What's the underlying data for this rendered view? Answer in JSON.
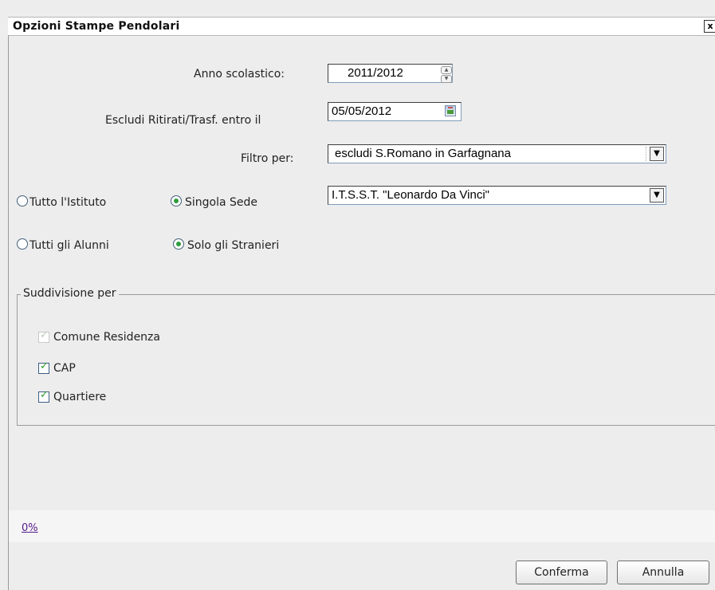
{
  "dialog": {
    "title": "Opzioni Stampe Pendolari",
    "close_label": "x"
  },
  "form": {
    "anno_label": "Anno scolastico:",
    "anno_value": "2011/2012",
    "escludi_label": "Escludi Ritirati/Trasf. entro il",
    "escludi_value": "05/05/2012",
    "filtro_label": "Filtro per:",
    "filtro_value": "escludi S.Romano in Garfagnana",
    "sede_value": "I.T.S.S.T. \"Leonardo Da Vinci\""
  },
  "radios": {
    "tutto_istituto": "Tutto l'Istituto",
    "singola_sede": "Singola Sede",
    "tutti_alunni": "Tutti gli Alunni",
    "solo_stranieri": "Solo gli Stranieri"
  },
  "suddivisione": {
    "legend": "Suddivisione per",
    "items": [
      {
        "label": "Comune Residenza",
        "checked": true,
        "disabled": true
      },
      {
        "label": "CAP",
        "checked": true,
        "disabled": false
      },
      {
        "label": "Quartiere",
        "checked": true,
        "disabled": false
      }
    ]
  },
  "progress": {
    "percent_text": "0%"
  },
  "buttons": {
    "confirm": "Conferma",
    "cancel": "Annulla"
  }
}
